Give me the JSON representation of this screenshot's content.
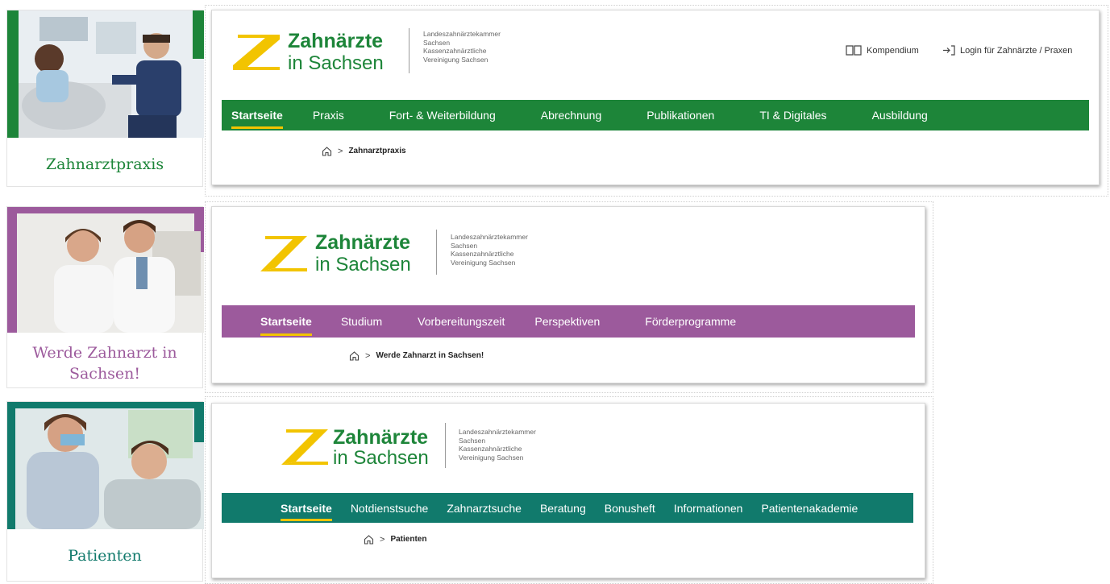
{
  "colors": {
    "green": "#1d8539",
    "purple": "#9c5a9c",
    "teal": "#117a6c",
    "accent_yellow": "#f2c400"
  },
  "sections": [
    {
      "card_title": "Zahnarztpraxis",
      "logo": {
        "line1": "Zahnärzte",
        "line2": "in Sachsen",
        "org1": "Landeszahnärztekammer",
        "org2": "Sachsen",
        "org3": "Kassenzahnärztliche",
        "org4": "Vereinigung Sachsen"
      },
      "top_links": {
        "kompendium": "Kompendium",
        "login": "Login für Zahnärzte / Praxen"
      },
      "nav": [
        "Startseite",
        "Praxis",
        "Fort- & Weiterbildung",
        "Abrechnung",
        "Publikationen",
        "TI & Digitales",
        "Ausbildung"
      ],
      "breadcrumb": "Zahnarztpraxis"
    },
    {
      "card_title_line1": "Werde Zahnarzt in",
      "card_title_line2": "Sachsen!",
      "logo": {
        "line1": "Zahnärzte",
        "line2": "in Sachsen",
        "org1": "Landeszahnärztekammer",
        "org2": "Sachsen",
        "org3": "Kassenzahnärztliche",
        "org4": "Vereinigung Sachsen"
      },
      "nav": [
        "Startseite",
        "Studium",
        "Vorbereitungszeit",
        "Perspektiven",
        "Förderprogramme"
      ],
      "breadcrumb": "Werde Zahnarzt in Sachsen!"
    },
    {
      "card_title": "Patienten",
      "logo": {
        "line1": "Zahnärzte",
        "line2": "in Sachsen",
        "org1": "Landeszahnärztekammer",
        "org2": "Sachsen",
        "org3": "Kassenzahnärztliche",
        "org4": "Vereinigung Sachsen"
      },
      "nav": [
        "Startseite",
        "Notdienstsuche",
        "Zahnarztsuche",
        "Beratung",
        "Bonusheft",
        "Informationen",
        "Patientenakademie"
      ],
      "breadcrumb": "Patienten"
    }
  ]
}
